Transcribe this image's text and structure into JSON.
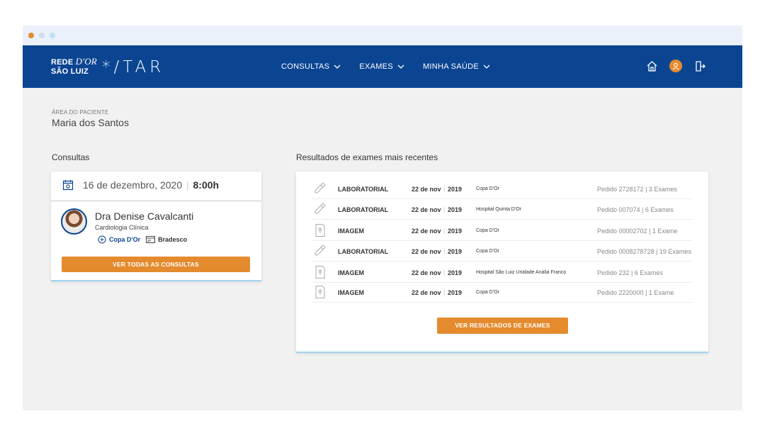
{
  "window": {
    "dots": [
      "#e48b2e",
      "#d3dbe6",
      "#bfe1f6"
    ]
  },
  "brand": {
    "rede_line1": "REDE",
    "rede_dor": "D'OR",
    "rede_line2": "SÃO LUIZ",
    "star": "*/TAR",
    "primary_color": "#0b4592",
    "accent_color": "#e48b2e"
  },
  "nav": {
    "items": [
      {
        "label": "CONSULTAS"
      },
      {
        "label": "EXAMES"
      },
      {
        "label": "MINHA SAÚDE"
      }
    ],
    "icons": [
      "home-icon",
      "user-avatar-icon",
      "logout-icon"
    ]
  },
  "patient": {
    "area_label": "ÁREA DO PACIENTE",
    "name": "Maria dos Santos"
  },
  "consultas": {
    "title": "Consultas",
    "date": "16 de dezembro, 2020",
    "time": "8:00h",
    "doctor": "Dra Denise Cavalcanti",
    "specialty": "Cardiologia Clínica",
    "hospital": "Copa D'Or",
    "plan": "Bradesco",
    "button": "VER TODAS AS CONSULTAS"
  },
  "exames": {
    "title": "Resultados de exames mais recentes",
    "rows": [
      {
        "icon": "test-tube-icon",
        "type": "LABORATORIAL",
        "date": "22 de nov",
        "year": "2019",
        "hospital": "Copa D'Or",
        "pedido": "Pedido 2728172 | 3 Exames"
      },
      {
        "icon": "test-tube-icon",
        "type": "LABORATORIAL",
        "date": "22 de nov",
        "year": "2019",
        "hospital": "Hospital Quinta D'Or",
        "pedido": "Pedido 007074 | 6 Exames"
      },
      {
        "icon": "xray-icon",
        "type": "IMAGEM",
        "date": "22 de nov",
        "year": "2019",
        "hospital": "Copa D'Or",
        "pedido": "Pedido 00002702 | 1 Exame"
      },
      {
        "icon": "test-tube-icon",
        "type": "LABORATORIAL",
        "date": "22 de nov",
        "year": "2019",
        "hospital": "Copa D'Or",
        "pedido": "Pedido 0008278728 | 19 Exames"
      },
      {
        "icon": "xray-icon",
        "type": "IMAGEM",
        "date": "22 de nov",
        "year": "2019",
        "hospital": "Hospital São Luiz Unidade Anália Franco",
        "pedido": "Pedido 232 | 6 Exames"
      },
      {
        "icon": "xray-icon",
        "type": "IMAGEM",
        "date": "22 de nov",
        "year": "2019",
        "hospital": "Copa D'Or",
        "pedido": "Pedido 2220000 | 1 Exame"
      }
    ],
    "button": "VER RESULTADOS DE EXAMES"
  }
}
